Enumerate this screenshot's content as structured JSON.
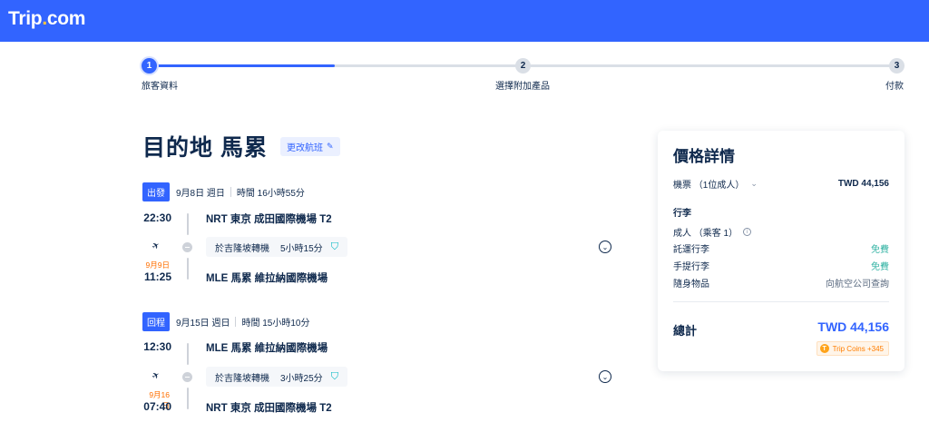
{
  "brand": {
    "name_main": "Trip",
    "name_dot": ".",
    "name_suffix": "com"
  },
  "steps": [
    {
      "number": "1",
      "label": "旅客資料",
      "state": "active"
    },
    {
      "number": "2",
      "label": "選擇附加產品",
      "state": "inactive"
    },
    {
      "number": "3",
      "label": "付款",
      "state": "inactive"
    }
  ],
  "progress_fraction": 0.25,
  "destination": {
    "title": "目的地 馬累",
    "change_label": "更改航班"
  },
  "outbound": {
    "badge": "出發",
    "date": "9月8日 週日",
    "duration": "時間 16小時55分",
    "depart_time": "22:30",
    "depart_airport": "NRT 東京 成田國際機場 T2",
    "transfer_place": "於吉隆坡轉機",
    "transfer_time": "5小時15分",
    "arrive_date": "9月9日",
    "arrive_time": "11:25",
    "arrive_airport": "MLE 馬累 維拉納國際機場"
  },
  "inbound": {
    "badge": "回程",
    "date": "9月15日 週日",
    "duration": "時間 15小時10分",
    "depart_time": "12:30",
    "depart_airport": "MLE 馬累 維拉納國際機場",
    "transfer_place": "於吉隆坡轉機",
    "transfer_time": "3小時25分",
    "arrive_date": "9月16日",
    "arrive_time": "07:40",
    "arrive_airport": "NRT 東京 成田國際機場 T2"
  },
  "price": {
    "title": "價格詳情",
    "ticket_label": "機票 （1位成人）",
    "ticket_value": "TWD 44,156",
    "baggage_title": "行李",
    "passenger_label": "成人 （乘客 1）",
    "checked_label": "託運行李",
    "checked_value": "免費",
    "carryon_label": "手提行李",
    "carryon_value": "免費",
    "personal_label": "隨身物品",
    "personal_value": "向航空公司查詢",
    "total_label": "總計",
    "total_value": "TWD 44,156",
    "coins_label": "Trip Coins +345"
  },
  "colors": {
    "brand": "#3264ff",
    "free": "#36b4a5",
    "next_day": "#ff6f00",
    "coins": "#ff7d00"
  },
  "icons": [
    "plane-icon",
    "transfer-icon",
    "shield-icon",
    "chevron-down-icon",
    "info-icon",
    "edit-icon",
    "coin-icon"
  ]
}
